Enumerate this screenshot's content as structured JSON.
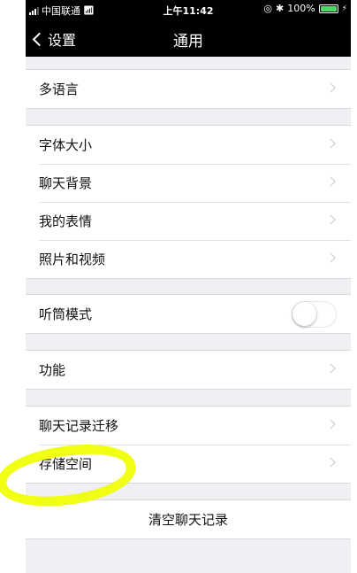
{
  "status_bar": {
    "carrier": "中国联通",
    "time": "上午11:42",
    "battery": "100%"
  },
  "nav": {
    "back_label": "设置",
    "title": "通用"
  },
  "settings": {
    "language": "多语言",
    "font_size": "字体大小",
    "chat_background": "聊天背景",
    "my_stickers": "我的表情",
    "photos_videos": "照片和视频",
    "earpiece_mode": "听筒模式",
    "features": "功能",
    "chat_history_migration": "聊天记录迁移",
    "storage": "存储空间",
    "clear_chat_history": "清空聊天记录"
  },
  "toggles": {
    "earpiece_mode_on": false
  },
  "colors": {
    "highlight": "#f0ff00",
    "toggle_off_border": "#e5e5ea",
    "battery": "#4cd964"
  },
  "icons": [
    "wifi-icon",
    "location-lock-icon",
    "bluetooth-icon",
    "battery-icon",
    "charging-icon",
    "chevron-left-icon",
    "chevron-right-icon"
  ]
}
